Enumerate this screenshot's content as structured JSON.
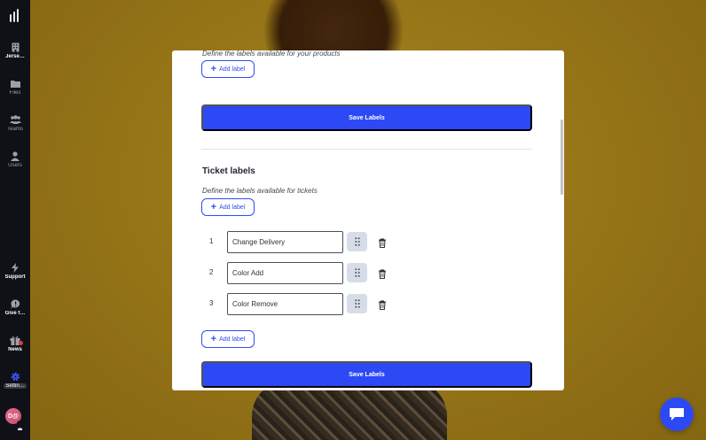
{
  "sidebar": {
    "items": [
      {
        "label": "Jerse…",
        "icon": "building-icon"
      },
      {
        "label": "Files",
        "icon": "folder-icon"
      },
      {
        "label": "Teams",
        "icon": "people-icon"
      },
      {
        "label": "Users",
        "icon": "user-icon"
      },
      {
        "label": "Support",
        "icon": "lightning-icon"
      },
      {
        "label": "Give f…",
        "icon": "feedback-icon"
      },
      {
        "label": "News",
        "icon": "gift-icon"
      },
      {
        "label": "Settin…",
        "icon": "gear-icon"
      }
    ],
    "avatar_initials": "D@"
  },
  "product_labels": {
    "hint": "Define the labels available for your products",
    "add_label": "Add label",
    "save_label": "Save Labels"
  },
  "ticket_labels": {
    "title": "Ticket labels",
    "hint": "Define the labels available for tickets",
    "add_label_top": "Add label",
    "add_label_bottom": "Add label",
    "save_label": "Save Labels",
    "rows": [
      {
        "index": "1",
        "value": "Change Delivery"
      },
      {
        "index": "2",
        "value": "Color Add"
      },
      {
        "index": "3",
        "value": "Color Remove"
      }
    ]
  },
  "colors": {
    "accent": "#2d49f5",
    "sidebar_bg": "#0f1117",
    "notification_dot": "#e53935"
  }
}
